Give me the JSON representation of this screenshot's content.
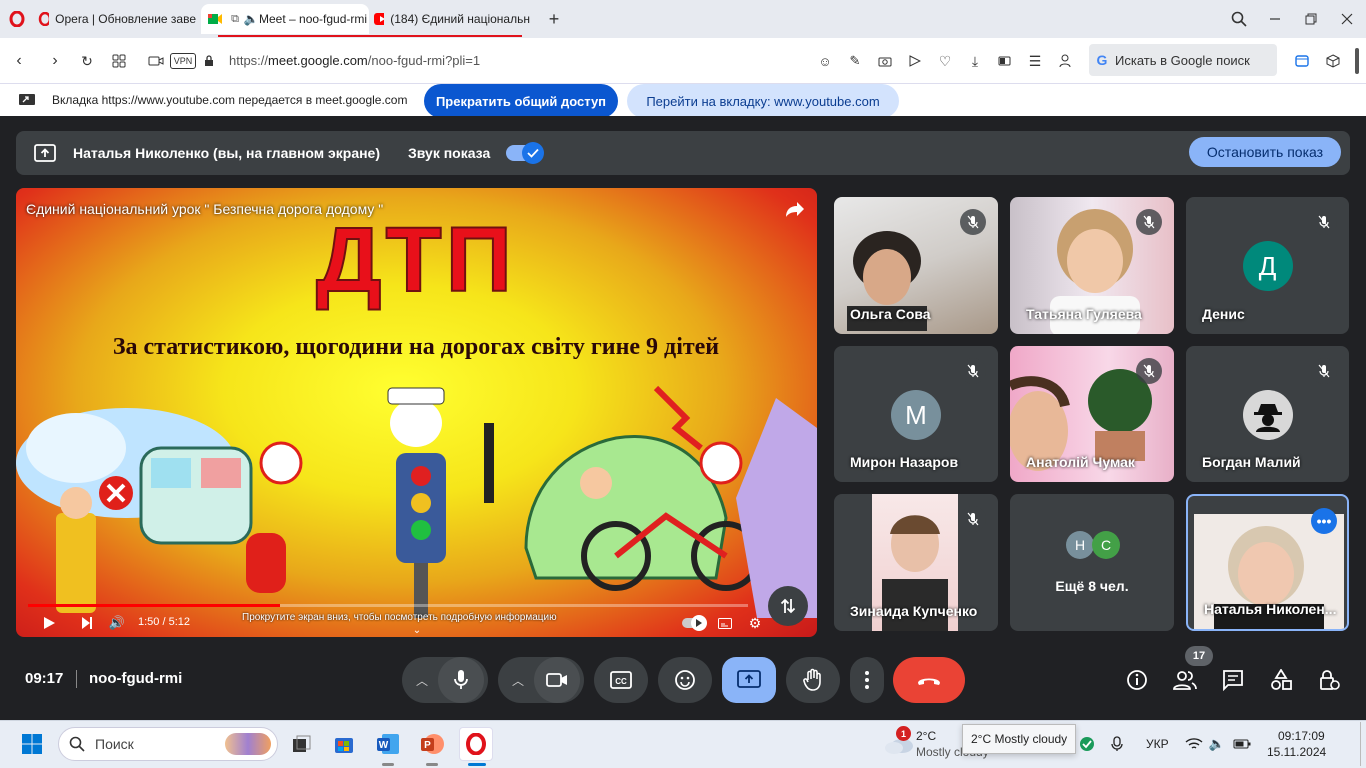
{
  "browser": {
    "tabs": [
      {
        "label": "Opera | Обновление заве"
      },
      {
        "label": "Meet – noo-fgud-rmi"
      },
      {
        "label": "(184) Єдиний національн"
      }
    ],
    "url_prefix": "https://",
    "url_host": "meet.google.com",
    "url_path": "/noo-fgud-rmi?pli=1",
    "vpn_label": "VPN",
    "search_placeholder": "Искать в Google поиск"
  },
  "share_notice": {
    "text": "Вкладка https://www.youtube.com передается в meet.google.com",
    "stop_button": "Прекратить общий доступ",
    "goto_button": "Перейти на вкладку: www.youtube.com"
  },
  "meet": {
    "presenter_label": "Наталья Николенко (вы, на главном экране)",
    "sound_label": "Звук показа",
    "stop_share_button": "Остановить показ",
    "video": {
      "title": "Єдиний національний урок \" Безпечна дорога додому \"",
      "headline": "ДТП",
      "subtitle": "За статистикою, щогодини на дорогах світу гине 9 дітей",
      "time": "1:50 / 5:12",
      "progress_fraction": 0.35,
      "hint": "Прокрутите экран вниз, чтобы посмотреть подробную информацию"
    },
    "participants": [
      {
        "name": "Ольга Сова"
      },
      {
        "name": "Татьяна Гуляева"
      },
      {
        "name": "Денис",
        "initial": "Д"
      },
      {
        "name": "Мирон Назаров",
        "initial": "М"
      },
      {
        "name": "Анатолій Чумак"
      },
      {
        "name": "Богдан Малий"
      },
      {
        "name": "Зинаида Купченко"
      },
      {
        "name": "Ещё 8 чел.",
        "initials": [
          "Н",
          "С"
        ]
      },
      {
        "name": "Наталья Николен..."
      }
    ],
    "clock": "09:17",
    "meeting_code": "noo-fgud-rmi",
    "participants_count": "17",
    "colors": {
      "end_call": "#ea4335",
      "accent": "#8ab4f8",
      "denis_avatar": "#00897b",
      "miron_avatar": "#78909c"
    }
  },
  "taskbar": {
    "search_label": "Поиск",
    "weather_temp": "2°C",
    "weather_desc": "Mostly cloudy",
    "weather_badge": "1",
    "tooltip": "2°C Mostly cloudy",
    "lang": "УКР",
    "time": "09:17:09",
    "date": "15.11.2024"
  }
}
